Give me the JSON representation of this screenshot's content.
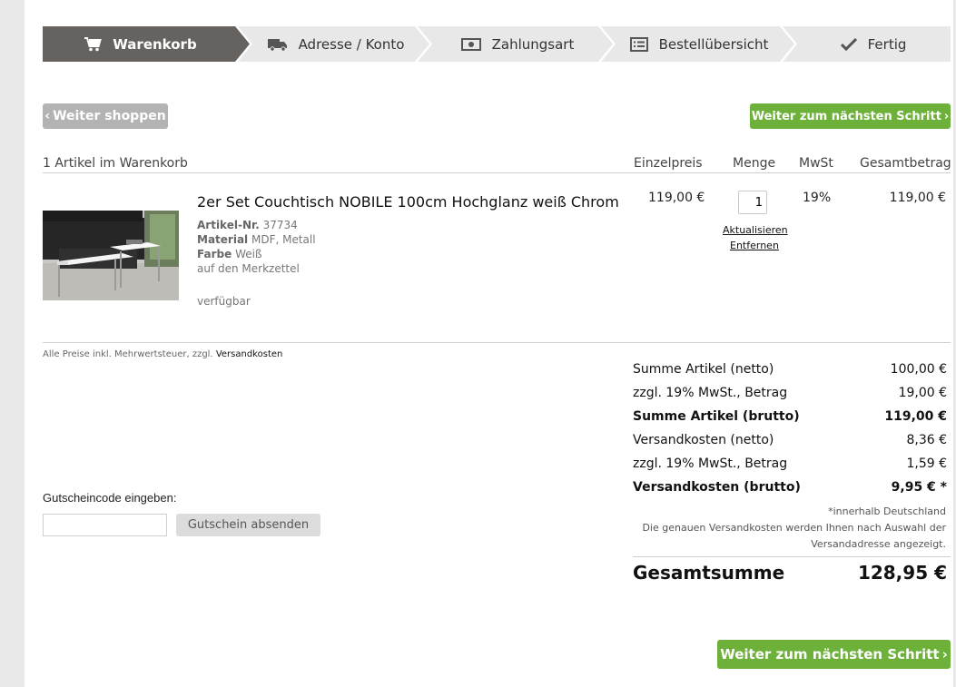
{
  "colors": {
    "accent_green": "#6db13a",
    "step_active": "#66625f",
    "step_inactive": "#e8e8e8",
    "button_grey": "#b3b3b3"
  },
  "stepper": {
    "steps": [
      {
        "label": "Warenkorb",
        "icon": "cart-icon"
      },
      {
        "label": "Adresse / Konto",
        "icon": "truck-icon"
      },
      {
        "label": "Zahlungsart",
        "icon": "money-icon"
      },
      {
        "label": "Bestellübersicht",
        "icon": "list-icon"
      },
      {
        "label": "Fertig",
        "icon": "check-icon"
      }
    ]
  },
  "nav": {
    "continue_shopping": "Weiter shoppen",
    "next_step": "Weiter zum nächsten Schritt",
    "next_step_bottom": "Weiter zum nächsten Schritt"
  },
  "cart": {
    "count_label": "1 Artikel im Warenkorb",
    "columns": {
      "unit_price": "Einzelpreis",
      "quantity": "Menge",
      "vat": "MwSt",
      "total": "Gesamtbetrag"
    },
    "item": {
      "title": "2er Set Couchtisch NOBILE 100cm Hochglanz weiß Chrom",
      "sku_label": "Artikel-Nr.",
      "sku": "37734",
      "material_label": "Material",
      "material": "MDF, Metall",
      "color_label": "Farbe",
      "color": "Weiß",
      "wishlist": "auf den Merkzettel",
      "availability": "verfügbar",
      "unit_price": "119,00 €",
      "quantity": "1",
      "update": "Aktualisieren",
      "remove": "Entfernen",
      "vat": "19%",
      "total": "119,00 €"
    }
  },
  "price_note": {
    "text": "Alle Preise inkl. Mehrwertsteuer, zzgl.",
    "link": "Versandkosten"
  },
  "voucher": {
    "label": "Gutscheincode eingeben:",
    "value": "",
    "placeholder": "",
    "button": "Gutschein absenden"
  },
  "summary": {
    "rows": [
      {
        "label": "Summe Artikel (netto)",
        "value": "100,00 €"
      },
      {
        "label": "zzgl. 19% MwSt., Betrag",
        "value": "19,00 €"
      },
      {
        "label": "Summe Artikel (brutto)",
        "value": "119,00 €"
      },
      {
        "label": "Versandkosten (netto)",
        "value": "8,36 €"
      },
      {
        "label": "zzgl. 19% MwSt., Betrag",
        "value": "1,59 €"
      },
      {
        "label": "Versandkosten (brutto)",
        "value": "9,95 € *"
      }
    ],
    "note1": "*innerhalb Deutschland",
    "note2": "Die genauen Versandkosten werden Ihnen nach Auswahl der",
    "note3": "Versandadresse angezeigt.",
    "grand_label": "Gesamtsumme",
    "grand_value": "128,95 €"
  }
}
